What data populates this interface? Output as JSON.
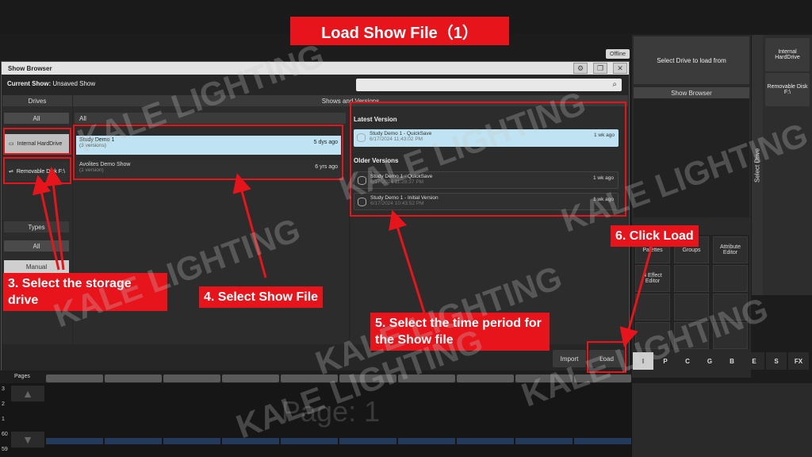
{
  "banner": "Load Show File（1）",
  "status": "Offline",
  "window": {
    "title": "Show Browser",
    "current_show_label": "Current Show:",
    "current_show_value": "Unsaved Show"
  },
  "drives": {
    "header": "Drives",
    "all": "All",
    "items": [
      {
        "label": "Internal HardDrive",
        "icon": "drive-icon"
      },
      {
        "label": "Removable Disk F:\\",
        "icon": "usb-icon"
      }
    ]
  },
  "types": {
    "header": "Types",
    "all": "All",
    "manual": "Manual"
  },
  "shows": {
    "header": "Shows and Versions",
    "tab_all": "All",
    "items": [
      {
        "name": "Study Demo 1",
        "sub": "(3 versions)",
        "age": "5 dys ago"
      },
      {
        "name": "Avolites Demo Show",
        "sub": "(1 version)",
        "age": "6 yrs ago"
      }
    ]
  },
  "versions": {
    "latest_header": "Latest Version",
    "older_header": "Older Versions",
    "latest": {
      "name": "Study Demo 1 - QuickSave",
      "date": "6/17/2024 11:43:02 PM",
      "age": "1 wk ago"
    },
    "older": [
      {
        "name": "Study Demo 1 - QuickSave",
        "date": "6/17/2024 11:28:37 PM",
        "age": "1 wk ago"
      },
      {
        "name": "Study Demo 1 - Initial Version",
        "date": "6/17/2024 10:43:52 PM",
        "age": "1 wk ago"
      }
    ]
  },
  "buttons": {
    "import": "Import",
    "load": "Load"
  },
  "right": {
    "select_drive_prompt": "Select Drive to load from",
    "show_browser": "Show Browser",
    "select_drive_vertical": "Select Drive",
    "drives": [
      "Internal HardDrive",
      "Removable Disk F:\\"
    ],
    "grid": [
      "Palettes",
      "Groups",
      "Attribute Editor",
      "4 Effect Editor"
    ],
    "letters": [
      "I",
      "P",
      "C",
      "G",
      "B",
      "E",
      "S",
      "FX"
    ]
  },
  "pages": {
    "label": "Pages",
    "numbers": [
      "3",
      "2",
      "1",
      "60",
      "59"
    ],
    "page_text": "Page: 1"
  },
  "annotations": {
    "step3": "3. Select the storage drive",
    "step4": "4. Select Show File",
    "step5": "5. Select the time period for the Show file",
    "step6": "6. Click Load"
  },
  "watermark": "KALE LIGHTING",
  "colors": {
    "accent": "#e8141c",
    "selected": "#bfe3f2"
  }
}
